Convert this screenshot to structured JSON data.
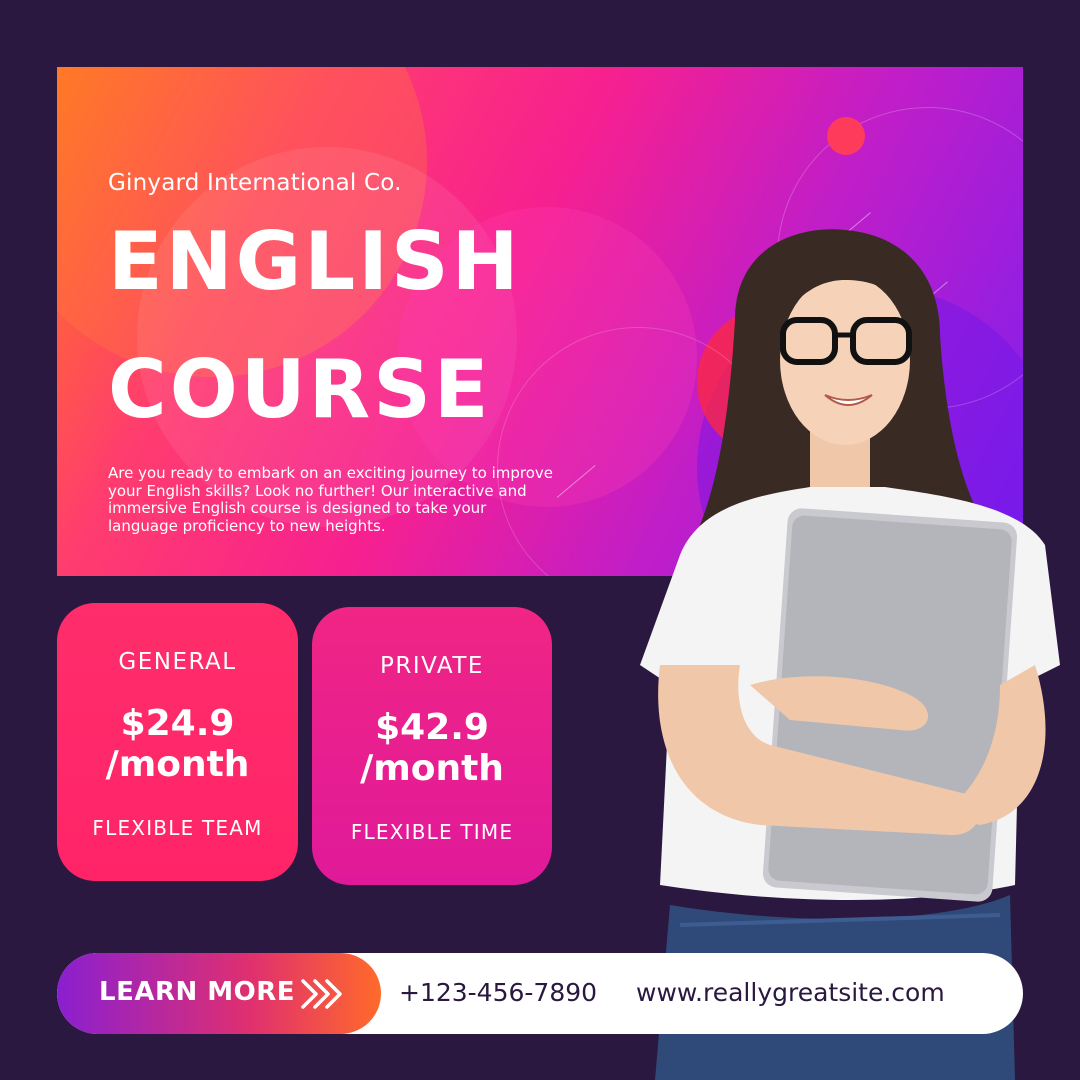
{
  "banner": {
    "company": "Ginyard International Co.",
    "headline_line1": "ENGLISH",
    "headline_line2": "COURSE",
    "description": "Are you ready to embark on an exciting journey to improve your English skills? Look no further! Our interactive and immersive English course is designed to take your language proficiency to new heights."
  },
  "plans": [
    {
      "title": "GENERAL",
      "price": "$24.9",
      "period": "/month",
      "feature": "FLEXIBLE TEAM"
    },
    {
      "title": "PRIVATE",
      "price": "$42.9",
      "period": "/month",
      "feature": "FLEXIBLE TIME"
    }
  ],
  "cta": {
    "label": "LEARN MORE",
    "icon": "double-chevron-right-icon"
  },
  "contact": {
    "phone": "+123-456-7890",
    "website": "www.reallygreatsite.com"
  },
  "colors": {
    "background": "#2a1840",
    "card_general": "#ff2d6b",
    "card_private": "#e0199a",
    "cta_start": "#8a1fd0",
    "cta_end": "#ff6a2a"
  }
}
